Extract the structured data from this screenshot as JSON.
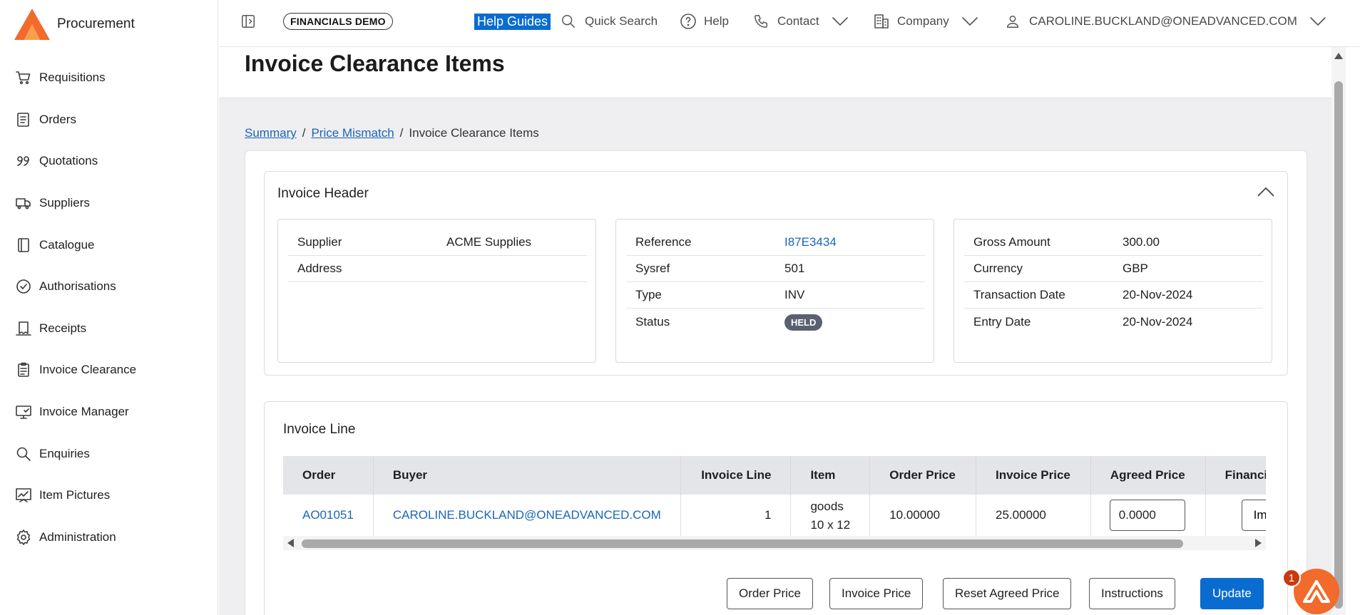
{
  "app": {
    "name": "Procurement",
    "brand_colors": {
      "orange": "#f26a2c",
      "primary_blue": "#0a6cd0",
      "link": "#1a66b8"
    }
  },
  "sidebar": {
    "items": [
      {
        "label": "Requisitions",
        "icon": "cart-icon"
      },
      {
        "label": "Orders",
        "icon": "orders-document-icon"
      },
      {
        "label": "Quotations",
        "icon": "quote-icon"
      },
      {
        "label": "Suppliers",
        "icon": "truck-icon"
      },
      {
        "label": "Catalogue",
        "icon": "book-icon"
      },
      {
        "label": "Authorisations",
        "icon": "check-circle-icon"
      },
      {
        "label": "Receipts",
        "icon": "receipt-icon"
      },
      {
        "label": "Invoice Clearance",
        "icon": "clipboard-icon"
      },
      {
        "label": "Invoice Manager",
        "icon": "monitor-icon"
      },
      {
        "label": "Enquiries",
        "icon": "search-icon"
      },
      {
        "label": "Item Pictures",
        "icon": "chart-icon"
      },
      {
        "label": "Administration",
        "icon": "gear-icon"
      }
    ]
  },
  "topbar": {
    "env_badge": "FINANCIALS DEMO",
    "help_guides": "Help Guides",
    "quick_search": "Quick Search",
    "help": "Help",
    "contact": "Contact",
    "company": "Company",
    "user": "CAROLINE.BUCKLAND@ONEADVANCED.COM"
  },
  "page": {
    "title": "Invoice Clearance Items",
    "breadcrumb": [
      "Summary",
      "Price Mismatch",
      "Invoice Clearance Items"
    ]
  },
  "invoice_header": {
    "title": "Invoice Header",
    "supplier_card": [
      {
        "label": "Supplier",
        "value": "ACME Supplies"
      },
      {
        "label": "Address",
        "value": ""
      }
    ],
    "reference_card": {
      "reference_label": "Reference",
      "reference_value": "I87E3434",
      "sysref_label": "Sysref",
      "sysref_value": "501",
      "type_label": "Type",
      "type_value": "INV",
      "status_label": "Status",
      "status_value": "HELD"
    },
    "amount_card": [
      {
        "label": "Gross Amount",
        "value": "300.00"
      },
      {
        "label": "Currency",
        "value": "GBP"
      },
      {
        "label": "Transaction Date",
        "value": "20-Nov-2024"
      },
      {
        "label": "Entry Date",
        "value": "20-Nov-2024"
      }
    ]
  },
  "invoice_line": {
    "title": "Invoice Line",
    "columns": [
      "Order",
      "Buyer",
      "Invoice Line",
      "Item",
      "Order Price",
      "Invoice Price",
      "Agreed Price",
      "Financia"
    ],
    "row": {
      "order": "AO01051",
      "buyer": "CAROLINE.BUCKLAND@ONEADVANCED.COM",
      "invoice_line": "1",
      "item_line1": "goods",
      "item_line2": "10 x 12",
      "order_price": "10.00000",
      "invoice_price": "25.00000",
      "agreed_price": "0.0000",
      "financial_button": "Imp"
    },
    "buttons": {
      "order_price": "Order Price",
      "invoice_price": "Invoice Price",
      "reset_agreed_price": "Reset Agreed Price",
      "instructions": "Instructions",
      "update": "Update"
    }
  },
  "assistant": {
    "badge_count": "1"
  }
}
